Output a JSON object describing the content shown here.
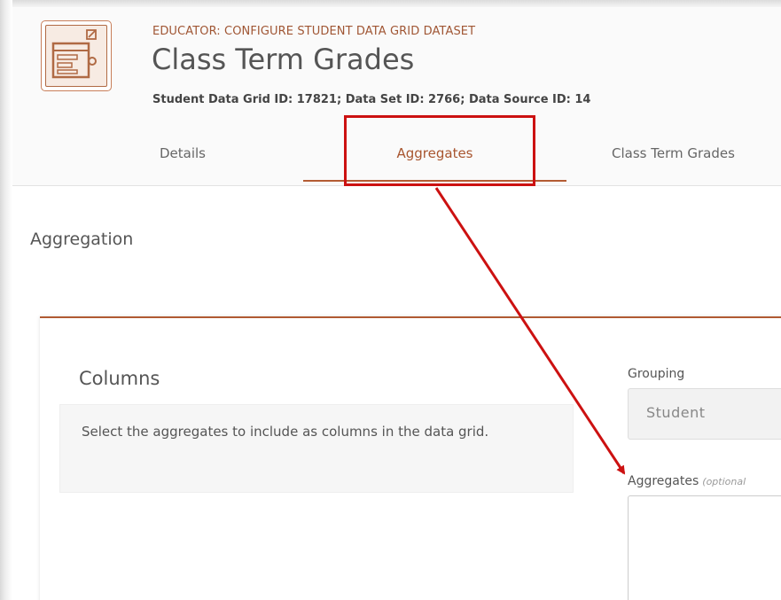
{
  "header": {
    "eyebrow": "EDUCATOR: CONFIGURE STUDENT DATA GRID DATASET",
    "title": "Class Term Grades",
    "subtitle": "Student Data Grid ID: 17821; Data Set ID: 2766; Data Source ID: 14"
  },
  "tabs": [
    {
      "label": "Details",
      "active": false
    },
    {
      "label": "Aggregates",
      "active": true
    },
    {
      "label": "Class Term Grades",
      "active": false
    }
  ],
  "section": {
    "heading": "Aggregation"
  },
  "columns_panel": {
    "heading": "Columns",
    "help_text": "Select the aggregates to include as columns in the data grid."
  },
  "grouping": {
    "label": "Grouping",
    "value": "Student"
  },
  "aggregates": {
    "label": "Aggregates",
    "optional_text": "(optional"
  },
  "annotation": {
    "color": "#cc1111"
  },
  "colors": {
    "accent": "#a8552f",
    "brand_border": "#b05a32"
  }
}
